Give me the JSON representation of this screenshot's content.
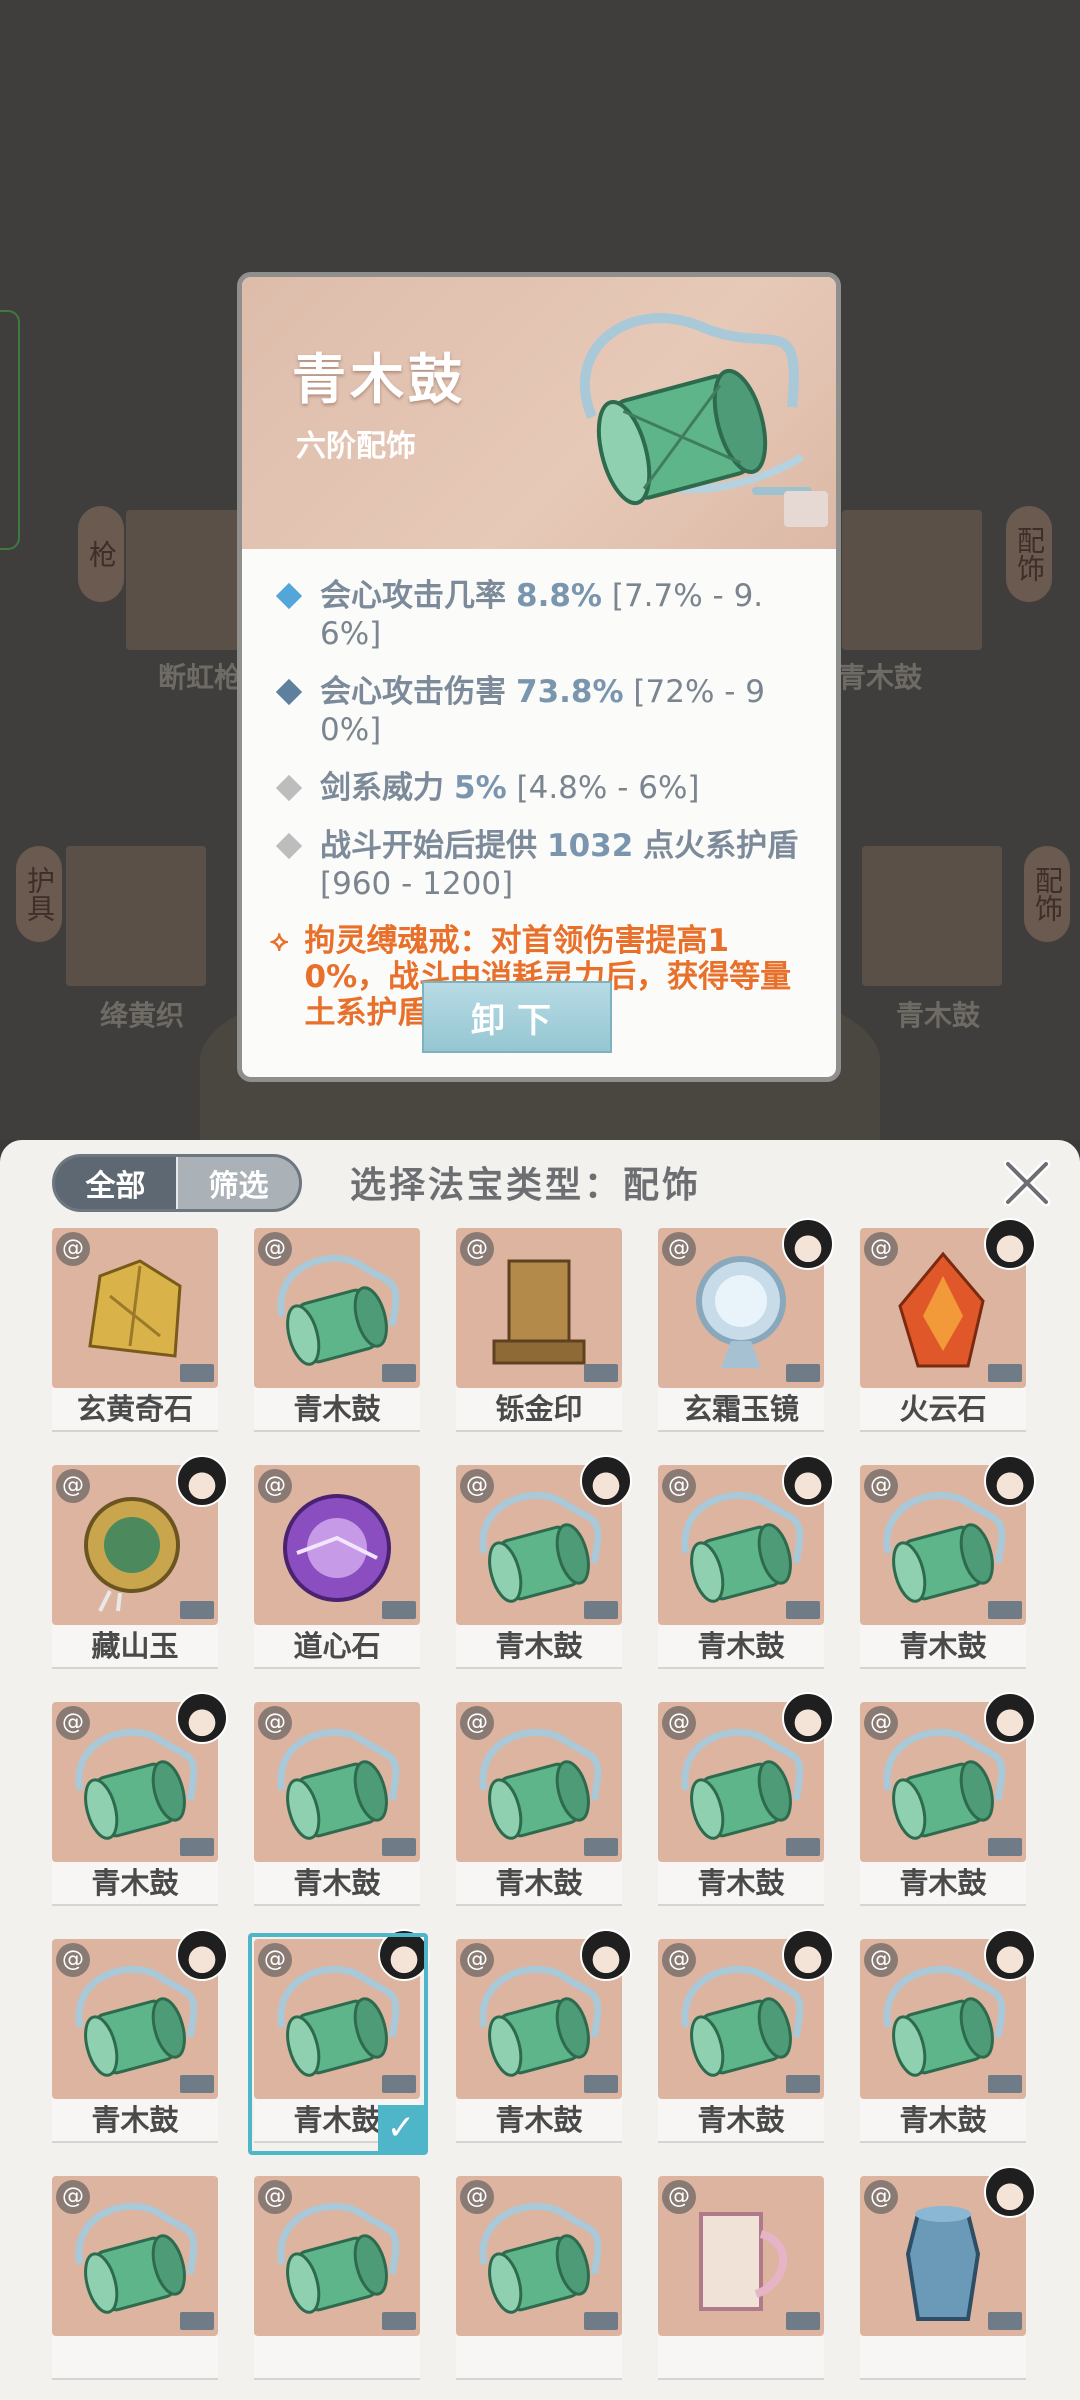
{
  "background": {
    "labels": [
      "断虹枪",
      "青木鼓",
      "绛黄织",
      "青木鼓"
    ],
    "side_tags": [
      "枪",
      "配饰",
      "护具",
      "配饰"
    ]
  },
  "detail": {
    "name": "青木鼓",
    "rank": "六阶配饰",
    "stats": [
      {
        "icon": "blue-diamond-icon",
        "name": "会心攻击几率",
        "value": "8.8%",
        "range": "[7.7% - 9.6%]",
        "color": "#55a6d8"
      },
      {
        "icon": "steel-diamond-icon",
        "name": "会心攻击伤害",
        "value": "73.8%",
        "range": "[72% - 90%]",
        "color": "#5f7f9e"
      },
      {
        "icon": "grey-diamond-icon",
        "name": "剑系威力",
        "value": "5%",
        "range": "[4.8% - 6%]",
        "color": "#bdbdbd"
      },
      {
        "icon": "grey-diamond-icon",
        "name": "战斗开始后提供",
        "value": "1032",
        "unit": "点火系护盾",
        "range": "[960 - 1200]",
        "color": "#bdbdbd"
      }
    ],
    "special": {
      "icon": "orange-chain-icon",
      "text": "拘灵缚魂戒：对首领伤害提高10%，战斗中消耗灵力后，获得等量土系护盾"
    },
    "unequip_label": "卸下"
  },
  "panel": {
    "tabs": {
      "all": "全部",
      "filter": "筛选"
    },
    "title": "选择法宝类型：配饰",
    "close_icon": "close-icon",
    "items": [
      {
        "label": "玄黄奇石",
        "art": "stone",
        "owner": false,
        "selected": false
      },
      {
        "label": "青木鼓",
        "art": "drum",
        "owner": false,
        "selected": false
      },
      {
        "label": "铄金印",
        "art": "seal",
        "owner": false,
        "selected": false
      },
      {
        "label": "玄霜玉镜",
        "art": "mirror",
        "owner": true,
        "selected": false
      },
      {
        "label": "火云石",
        "art": "fire",
        "owner": true,
        "selected": false
      },
      {
        "label": "藏山玉",
        "art": "jade",
        "owner": true,
        "selected": false
      },
      {
        "label": "道心石",
        "art": "orb",
        "owner": false,
        "selected": false
      },
      {
        "label": "青木鼓",
        "art": "drum",
        "owner": true,
        "selected": false
      },
      {
        "label": "青木鼓",
        "art": "drum",
        "owner": true,
        "selected": false
      },
      {
        "label": "青木鼓",
        "art": "drum",
        "owner": true,
        "selected": false
      },
      {
        "label": "青木鼓",
        "art": "drum",
        "owner": true,
        "selected": false
      },
      {
        "label": "青木鼓",
        "art": "drum",
        "owner": false,
        "selected": false
      },
      {
        "label": "青木鼓",
        "art": "drum",
        "owner": false,
        "selected": false
      },
      {
        "label": "青木鼓",
        "art": "drum",
        "owner": true,
        "selected": false
      },
      {
        "label": "青木鼓",
        "art": "drum",
        "owner": true,
        "selected": false
      },
      {
        "label": "青木鼓",
        "art": "drum",
        "owner": true,
        "selected": false
      },
      {
        "label": "青木鼓",
        "art": "drum",
        "owner": true,
        "selected": true
      },
      {
        "label": "青木鼓",
        "art": "drum",
        "owner": true,
        "selected": false
      },
      {
        "label": "青木鼓",
        "art": "drum",
        "owner": true,
        "selected": false
      },
      {
        "label": "青木鼓",
        "art": "drum",
        "owner": true,
        "selected": false
      },
      {
        "label": "",
        "art": "drum",
        "owner": false,
        "selected": false
      },
      {
        "label": "",
        "art": "drum",
        "owner": false,
        "selected": false
      },
      {
        "label": "",
        "art": "drum",
        "owner": false,
        "selected": false
      },
      {
        "label": "",
        "art": "scroll",
        "owner": false,
        "selected": false
      },
      {
        "label": "",
        "art": "vase",
        "owner": true,
        "selected": false
      }
    ]
  }
}
